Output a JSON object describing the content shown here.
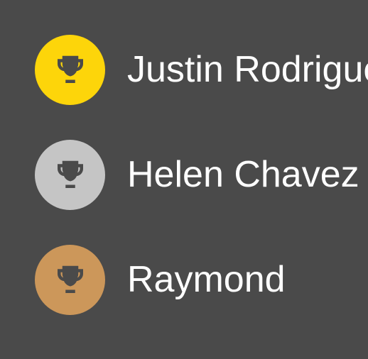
{
  "leaderboard": {
    "entries": [
      {
        "rank": 1,
        "name": "Justin Rodriguez",
        "medal": "gold",
        "medal_color": "#fdd50a",
        "icon": "trophy-icon"
      },
      {
        "rank": 2,
        "name": "Helen Chavez",
        "medal": "silver",
        "medal_color": "#c5c5c5",
        "icon": "trophy-icon"
      },
      {
        "rank": 3,
        "name": "Raymond",
        "medal": "bronze",
        "medal_color": "#cc975a",
        "icon": "trophy-icon"
      }
    ]
  },
  "colors": {
    "background": "#4a4a4a",
    "text": "#ffffff",
    "trophy": "#4a4a4a"
  }
}
